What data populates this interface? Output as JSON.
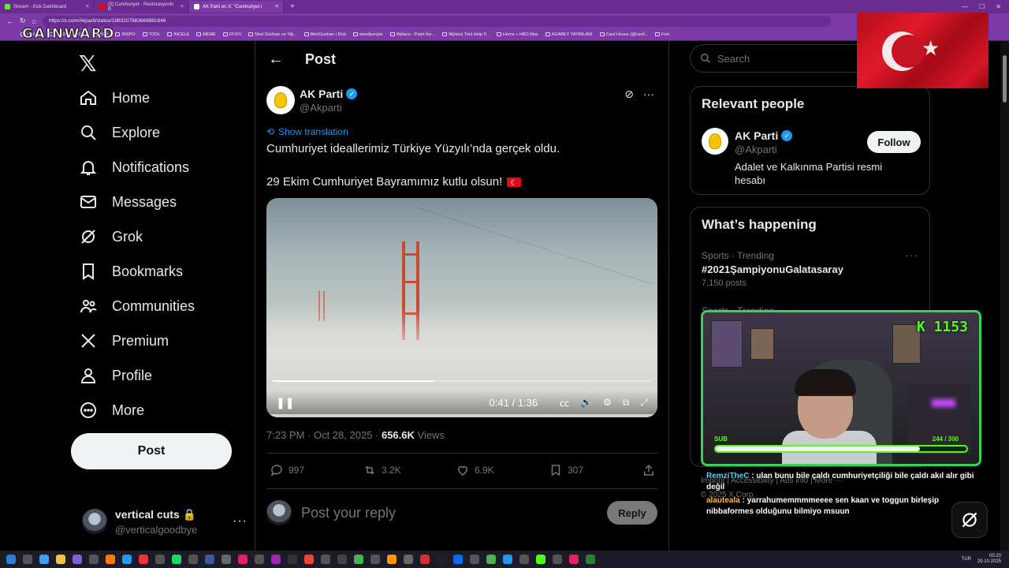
{
  "browser": {
    "tabs": [
      {
        "title": "Stream - Kick Dashboard",
        "color": "#53fc18",
        "active": false
      },
      {
        "title": "(5) Cumhuriyet - Restorasyonlu B",
        "color": "#ff0000",
        "active": false
      },
      {
        "title": "AK Parti on X: \"Cumhuriyet i",
        "color": "#ffffff",
        "active": true
      }
    ],
    "url": "https://x.com/Akparti/status/1983207883668881646",
    "bookmarks": [
      "GAMES",
      "WEIRD MUSIC",
      "JIRA",
      "INSPO",
      "TOOL",
      "İNCELE",
      "MEME",
      "FFXIV",
      "Mert Günhan ve Yiğ...",
      "MertGunhan | Kick",
      "wiredpeople",
      "Wplace - Paint the...",
      "Wplace Tool Help P...",
      "Home » HBO Max",
      "AGABEY YAYINLARI",
      "Card House (@card...",
      "Fort"
    ]
  },
  "overlay": {
    "logo": "GAINWARD",
    "k_count": "K 1153",
    "sub_label": "SUB",
    "sub_count": "244 / 300",
    "sub_progress": 0.813
  },
  "nav": {
    "items": [
      {
        "label": "Home",
        "icon": "home-icon"
      },
      {
        "label": "Explore",
        "icon": "search-icon"
      },
      {
        "label": "Notifications",
        "icon": "bell-icon"
      },
      {
        "label": "Messages",
        "icon": "mail-icon"
      },
      {
        "label": "Grok",
        "icon": "grok-icon"
      },
      {
        "label": "Bookmarks",
        "icon": "bookmark-icon"
      },
      {
        "label": "Communities",
        "icon": "communities-icon"
      },
      {
        "label": "Premium",
        "icon": "x-icon"
      },
      {
        "label": "Profile",
        "icon": "person-icon"
      },
      {
        "label": "More",
        "icon": "more-circle-icon"
      }
    ],
    "post_button": "Post",
    "account": {
      "name": "vertical cuts 🔒",
      "handle": "@verticalgoodbye"
    }
  },
  "post": {
    "header": "Post",
    "author_name": "AK Parti",
    "author_handle": "@Akparti",
    "show_translation": "Show translation",
    "text_line1": "Cumhuriyet ideallerimiz Türkiye Yüzyılı’nda gerçek oldu.",
    "text_line2": "29 Ekim Cumhuriyet Bayramımız kutlu olsun!",
    "video": {
      "time": "0:41 / 1:36",
      "progress": 0.427
    },
    "timestamp": "7:23 PM · Oct 28, 2025 · ",
    "views_count": "656.6K",
    "views_label": " Views",
    "replies": "997",
    "reposts": "3.2K",
    "likes": "6.9K",
    "bookmarks": "307",
    "reply_placeholder": "Post your reply",
    "reply_button": "Reply"
  },
  "sidebar": {
    "search_placeholder": "Search",
    "relevant_title": "Relevant people",
    "relevant_person": {
      "name": "AK Parti",
      "handle": "@Akparti",
      "bio": "Adalet ve Kalkınma Partisi resmi hesabı",
      "follow": "Follow"
    },
    "happening_title": "What’s happening",
    "trend": {
      "category": "Sports · Trending",
      "name": "#2021ŞampiyonuGalatasaray",
      "count": "7,150 posts"
    },
    "trend2_category": "Sports · Trending",
    "footer_links": "Imprint  |  Accessibility  |  Ads info  |  More ···",
    "footer_copy": "© 2025 X Corp."
  },
  "chat": [
    {
      "user": "RemziTheC",
      "text": "ulan bunu bile çaldı cumhuriyetçiliği bile çaldı akıl alır gibi değil"
    },
    {
      "user": "alauteala",
      "text": "yarrahumemmmmeeee sen kaan ve toggun birleşip nibbaformes olduğunu bilmiyo msuun"
    }
  ],
  "taskbar": {
    "lang": "TUR",
    "time": "00:20",
    "date": "29.10.2025"
  },
  "colors": {
    "accent": "#1d9bf0",
    "kick_green": "#53fc18",
    "browser_purple": "#7c3aa6"
  }
}
